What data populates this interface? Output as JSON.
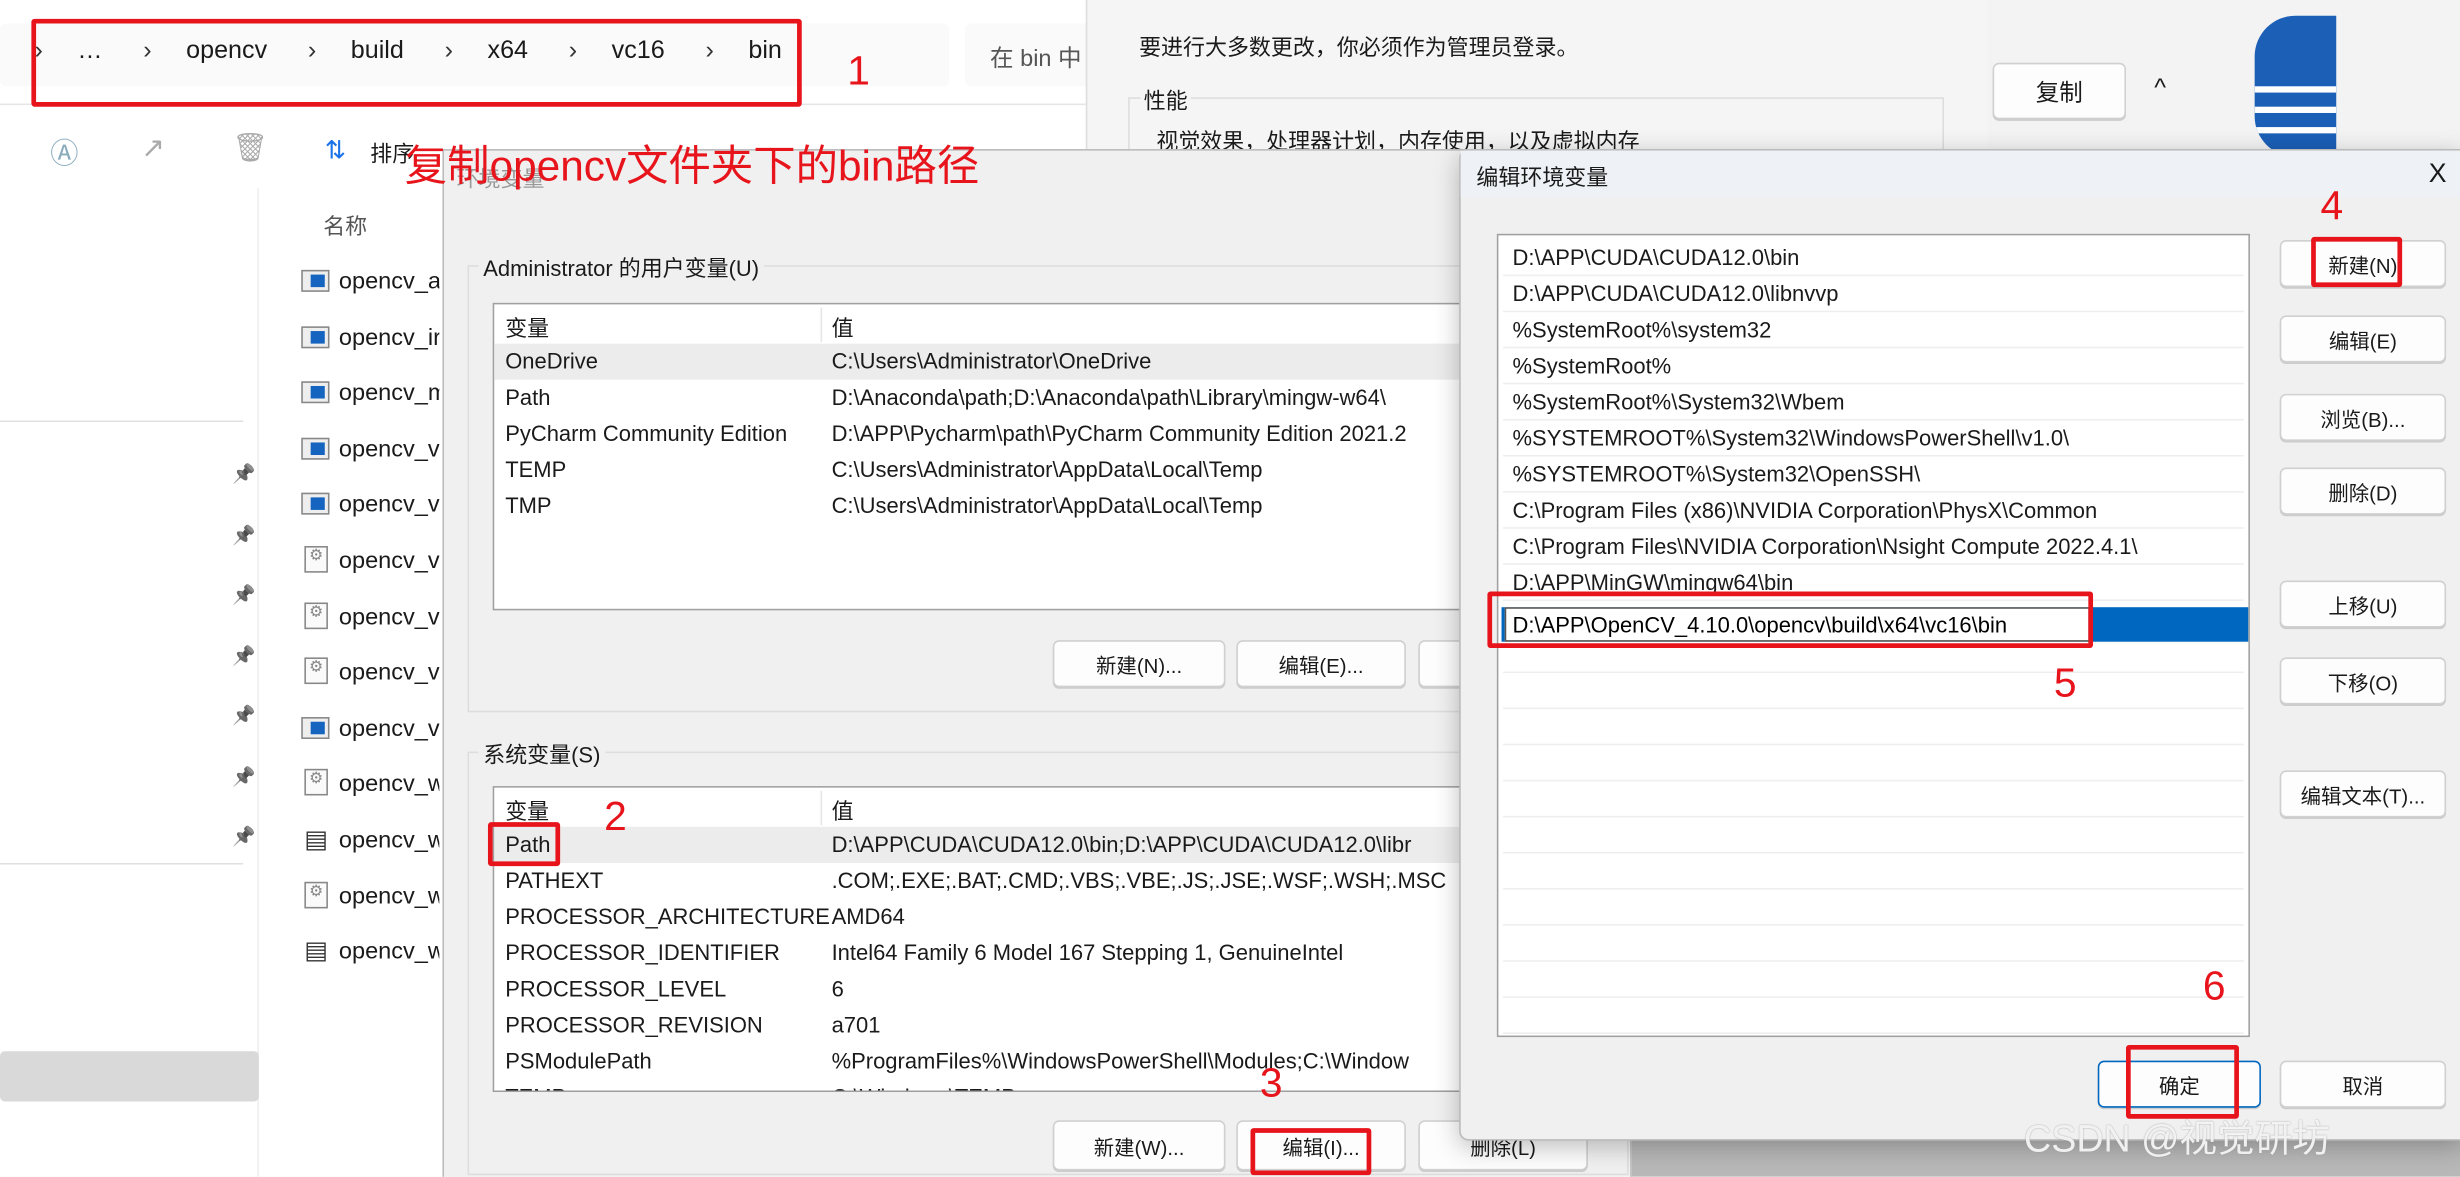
{
  "explorer": {
    "breadcrumb": [
      "…",
      "opencv",
      "build",
      "x64",
      "vc16",
      "bin"
    ],
    "search_placeholder": "在 bin 中",
    "sort_label": "排序",
    "column_name": "名称",
    "files": [
      {
        "name": "opencv_a",
        "type": "exe"
      },
      {
        "name": "opencv_ir",
        "type": "exe"
      },
      {
        "name": "opencv_m",
        "type": "exe"
      },
      {
        "name": "opencv_v",
        "type": "exe"
      },
      {
        "name": "opencv_v",
        "type": "exe"
      },
      {
        "name": "opencv_v",
        "type": "dll"
      },
      {
        "name": "opencv_v",
        "type": "dll"
      },
      {
        "name": "opencv_v",
        "type": "dll"
      },
      {
        "name": "opencv_v",
        "type": "exe"
      },
      {
        "name": "opencv_w",
        "type": "dll"
      },
      {
        "name": "opencv_w",
        "type": "cfg"
      },
      {
        "name": "opencv_w",
        "type": "dll"
      },
      {
        "name": "opencv_w",
        "type": "cfg"
      }
    ]
  },
  "system_properties": {
    "notice": "要进行大多数更改，你必须作为管理员登录。",
    "performance_group": "性能",
    "performance_desc": "视觉效果，处理器计划，内存使用，以及虚拟内存",
    "copy_label": "复制",
    "collapse_glyph": "^"
  },
  "env_dialog": {
    "title": "环境变量",
    "user_group": "Administrator 的用户变量(U)",
    "col_var": "变量",
    "col_val": "值",
    "user_vars": [
      {
        "name": "OneDrive",
        "value": "C:\\Users\\Administrator\\OneDrive"
      },
      {
        "name": "Path",
        "value": "D:\\Anaconda\\path;D:\\Anaconda\\path\\Library\\mingw-w64\\"
      },
      {
        "name": "PyCharm Community Edition",
        "value": "D:\\APP\\Pycharm\\path\\PyCharm Community Edition 2021.2"
      },
      {
        "name": "TEMP",
        "value": "C:\\Users\\Administrator\\AppData\\Local\\Temp"
      },
      {
        "name": "TMP",
        "value": "C:\\Users\\Administrator\\AppData\\Local\\Temp"
      }
    ],
    "user_new": "新建(N)...",
    "user_edit": "编辑(E)...",
    "system_group": "系统变量(S)",
    "system_vars": [
      {
        "name": "Path",
        "value": "D:\\APP\\CUDA\\CUDA12.0\\bin;D:\\APP\\CUDA\\CUDA12.0\\libr"
      },
      {
        "name": "PATHEXT",
        "value": ".COM;.EXE;.BAT;.CMD;.VBS;.VBE;.JS;.JSE;.WSF;.WSH;.MSC"
      },
      {
        "name": "PROCESSOR_ARCHITECTURE",
        "value": "AMD64"
      },
      {
        "name": "PROCESSOR_IDENTIFIER",
        "value": "Intel64 Family 6 Model 167 Stepping 1, GenuineIntel"
      },
      {
        "name": "PROCESSOR_LEVEL",
        "value": "6"
      },
      {
        "name": "PROCESSOR_REVISION",
        "value": "a701"
      },
      {
        "name": "PSModulePath",
        "value": "%ProgramFiles%\\WindowsPowerShell\\Modules;C:\\Window"
      },
      {
        "name": "TEMP",
        "value": "C:\\Windows\\TEMP"
      }
    ],
    "sys_new": "新建(W)...",
    "sys_edit": "编辑(I)...",
    "sys_delete": "删除(L)"
  },
  "edit_dialog": {
    "title": "编辑环境变量",
    "close_glyph": "X",
    "entries": [
      "D:\\APP\\CUDA\\CUDA12.0\\bin",
      "D:\\APP\\CUDA\\CUDA12.0\\libnvvp",
      "%SystemRoot%\\system32",
      "%SystemRoot%",
      "%SystemRoot%\\System32\\Wbem",
      "%SYSTEMROOT%\\System32\\WindowsPowerShell\\v1.0\\",
      "%SYSTEMROOT%\\System32\\OpenSSH\\",
      "C:\\Program Files (x86)\\NVIDIA Corporation\\PhysX\\Common",
      "C:\\Program Files\\NVIDIA Corporation\\Nsight Compute 2022.4.1\\",
      "D:\\APP\\MinGW\\mingw64\\bin"
    ],
    "editing_value": "D:\\APP\\OpenCV_4.10.0\\opencv\\build\\x64\\vc16\\bin",
    "buttons": {
      "new": "新建(N)",
      "edit": "编辑(E)",
      "browse": "浏览(B)...",
      "delete": "删除(D)",
      "up": "上移(U)",
      "down": "下移(O)",
      "edit_text": "编辑文本(T)..."
    },
    "ok": "确定",
    "cancel": "取消",
    "selection_color": "#0067c0"
  },
  "annotations": {
    "instruction": "复制opencv文件夹下的bin路径",
    "steps": [
      "1",
      "2",
      "3",
      "4",
      "5",
      "6"
    ],
    "color": "#e8141c"
  },
  "watermark": "CSDN @视觉研坊"
}
